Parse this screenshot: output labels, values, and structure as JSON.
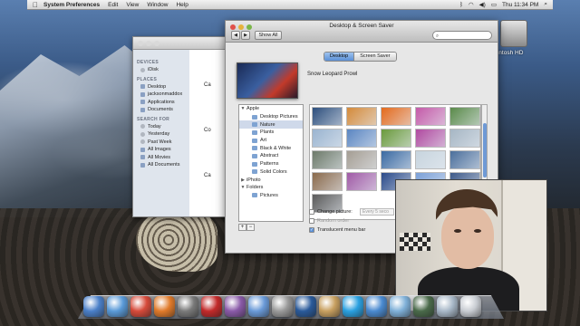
{
  "menubar": {
    "apple_icon": "apple-icon",
    "app_name": "System Preferences",
    "menus": [
      "Edit",
      "View",
      "Window",
      "Help"
    ],
    "clock": "Thu 11:34 PM",
    "status_icons": [
      "bluetooth-icon",
      "wifi-icon",
      "volume-icon",
      "battery-icon",
      "spotlight-icon"
    ]
  },
  "desktop": {
    "hd_label": "acintosh HD"
  },
  "finder": {
    "sidebar": {
      "devices_head": "DEVICES",
      "devices": [
        "iDisk"
      ],
      "places_head": "PLACES",
      "places": [
        "Desktop",
        "jacksonmaddox",
        "Applications",
        "Documents"
      ],
      "search_head": "SEARCH FOR",
      "search": [
        "Today",
        "Yesterday",
        "Past Week",
        "All Images",
        "All Movies",
        "All Documents"
      ]
    },
    "main_snippets": [
      "Ca",
      "Co",
      "Ca"
    ]
  },
  "prefs": {
    "title": "Desktop & Screen Saver",
    "show_all": "Show All",
    "back": "◀",
    "forward": "▶",
    "search_placeholder": "",
    "tabs": [
      "Desktop",
      "Screen Saver"
    ],
    "wallpaper_name": "Snow Leopard Prowl",
    "source_list": [
      {
        "label": "Apple",
        "kind": "group"
      },
      {
        "label": "Desktop Pictures",
        "kind": "folder"
      },
      {
        "label": "Nature",
        "kind": "folder",
        "selected": true
      },
      {
        "label": "Plants",
        "kind": "folder"
      },
      {
        "label": "Art",
        "kind": "folder"
      },
      {
        "label": "Black & White",
        "kind": "folder"
      },
      {
        "label": "Abstract",
        "kind": "folder"
      },
      {
        "label": "Patterns",
        "kind": "folder"
      },
      {
        "label": "Solid Colors",
        "kind": "folder"
      },
      {
        "label": "iPhoto",
        "kind": "group-collapsed"
      },
      {
        "label": "Folders",
        "kind": "group"
      },
      {
        "label": "Pictures",
        "kind": "folder"
      }
    ],
    "list_add": "+",
    "list_remove": "−",
    "thumbnail_colors": [
      "#2d4f7d",
      "#d48a3a",
      "#e46a1c",
      "#c45aa8",
      "#5a8a4a",
      "#9ab4d0",
      "#5b86c2",
      "#6a9a3c",
      "#b04aa0",
      "#a6b6c4",
      "#6d7a6a",
      "#a59e94",
      "#3a6aa2",
      "#c7d4de",
      "#4b6f9c",
      "#8a6a4c",
      "#a05aa6",
      "#2a4a8a",
      "#7ba0d8",
      "#3e5a8a",
      "#5a5a5a"
    ],
    "options": {
      "change_picture": "Change picture:",
      "change_picture_checked": false,
      "interval": "Every 5 seco",
      "random_order": "Random order",
      "random_order_checked": false,
      "translucent_menu_bar": "Translucent menu bar",
      "translucent_checked": true
    }
  },
  "dock": {
    "icons": [
      {
        "name": "finder-icon",
        "color": "#4a7fc8"
      },
      {
        "name": "safari-icon",
        "color": "#5a9ad8"
      },
      {
        "name": "chrome-icon",
        "color": "#d64a3a"
      },
      {
        "name": "firefox-icon",
        "color": "#e07a2a"
      },
      {
        "name": "system-preferences-icon",
        "color": "#7a7a7a"
      },
      {
        "name": "photo-booth-icon",
        "color": "#c22a2a"
      },
      {
        "name": "imovie-icon",
        "color": "#8a5aa8"
      },
      {
        "name": "itunes-icon",
        "color": "#6a9ad8"
      },
      {
        "name": "preview-icon",
        "color": "#9a9a9a"
      },
      {
        "name": "quicktime-icon",
        "color": "#2a5a9a"
      },
      {
        "name": "utility-icon",
        "color": "#c8a060"
      },
      {
        "name": "skype-icon",
        "color": "#2aa0e0"
      },
      {
        "name": "itunes-music-icon",
        "color": "#4a8ad0"
      },
      {
        "name": "app-icon",
        "color": "#7fb0d8"
      },
      {
        "name": "time-machine-icon",
        "color": "#4a6a4a"
      },
      {
        "name": "downloads-stack-icon",
        "color": "#a8b8c8"
      },
      {
        "name": "trash-icon",
        "color": "#c8ccd2"
      }
    ]
  }
}
